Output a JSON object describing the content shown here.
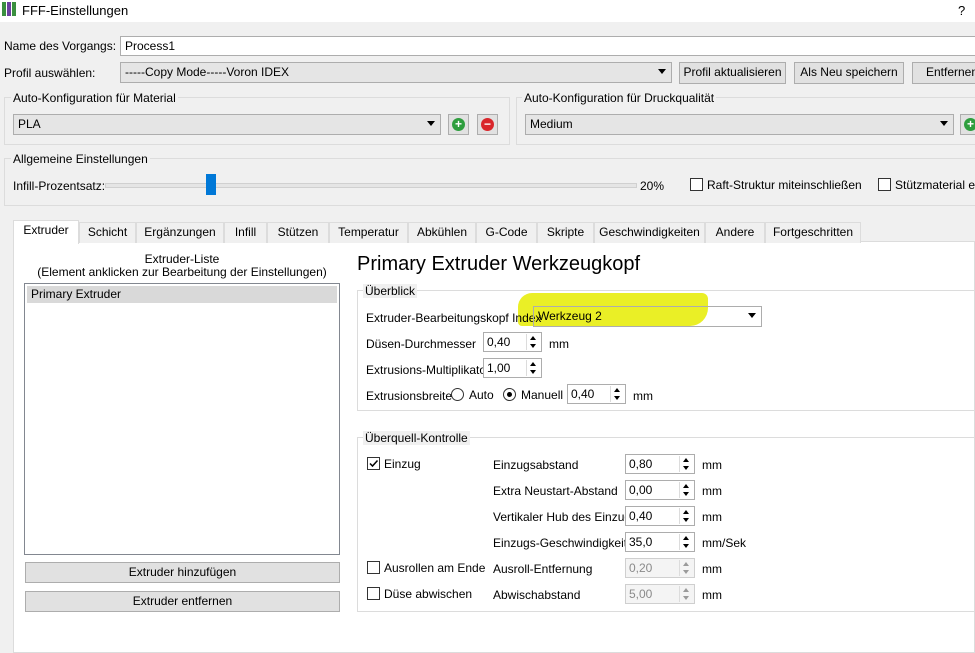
{
  "window": {
    "title": "FFF-Einstellungen",
    "help": "?"
  },
  "process": {
    "label": "Name des Vorgangs:",
    "value": "Process1"
  },
  "profile": {
    "label": "Profil auswählen:",
    "selected": "-----Copy Mode-----Voron IDEX",
    "update_button": "Profil aktualisieren",
    "save_new_button": "Als Neu speichern",
    "remove_button": "Entfernen"
  },
  "material": {
    "group_title": "Auto-Konfiguration für Material",
    "selected": "PLA"
  },
  "quality": {
    "group_title": "Auto-Konfiguration für Druckqualität",
    "selected": "Medium"
  },
  "general": {
    "group_title": "Allgemeine Einstellungen",
    "infill_label": "Infill-Prozentsatz:",
    "infill_value": "20%",
    "infill_fraction": 0.2,
    "raft_label": "Raft-Struktur miteinschließen",
    "support_label": "Stützmaterial erzeugen"
  },
  "tabs": [
    "Extruder",
    "Schicht",
    "Ergänzungen",
    "Infill",
    "Stützen",
    "Temperatur",
    "Abkühlen",
    "G-Code",
    "Skripte",
    "Geschwindigkeiten",
    "Andere",
    "Fortgeschritten"
  ],
  "extruder_list": {
    "title": "Extruder-Liste",
    "subtitle": "(Element anklicken zur Bearbeitung der Einstellungen)",
    "items": [
      "Primary Extruder"
    ],
    "add_button": "Extruder hinzufügen",
    "remove_button": "Extruder entfernen"
  },
  "details": {
    "heading": "Primary Extruder Werkzeugkopf",
    "overview": {
      "title": "Überblick",
      "toolhead_label": "Extruder-Bearbeitungskopf Index",
      "toolhead_value": "Werkzeug 2",
      "nozzle_label": "Düsen-Durchmesser",
      "nozzle_value": "0,40",
      "nozzle_unit": "mm",
      "multiplier_label": "Extrusions-Multiplikator",
      "multiplier_value": "1,00",
      "width_label": "Extrusionsbreite",
      "auto_label": "Auto",
      "manual_label": "Manuell",
      "width_value": "0,40",
      "width_unit": "mm"
    },
    "ooze": {
      "title": "Überquell-Kontrolle",
      "retract_label": "Einzug",
      "coast_label": "Ausrollen am Ende",
      "wipe_label": "Düse abwischen",
      "rows": [
        {
          "label": "Einzugsabstand",
          "value": "0,80",
          "unit": "mm"
        },
        {
          "label": "Extra Neustart-Abstand",
          "value": "0,00",
          "unit": "mm"
        },
        {
          "label": "Vertikaler Hub des Einzugs",
          "value": "0,40",
          "unit": "mm"
        },
        {
          "label": "Einzugs-Geschwindigkeit",
          "value": "35,0",
          "unit": "mm/Sek"
        },
        {
          "label": "Ausroll-Entfernung",
          "value": "0,20",
          "unit": "mm"
        },
        {
          "label": "Abwischabstand",
          "value": "5,00",
          "unit": "mm"
        }
      ]
    }
  },
  "colors": {
    "highlight": "#e6ec00",
    "slider_handle": "#0078d7",
    "add_icon": "#2e9e3e",
    "remove_icon": "#d9262b"
  }
}
